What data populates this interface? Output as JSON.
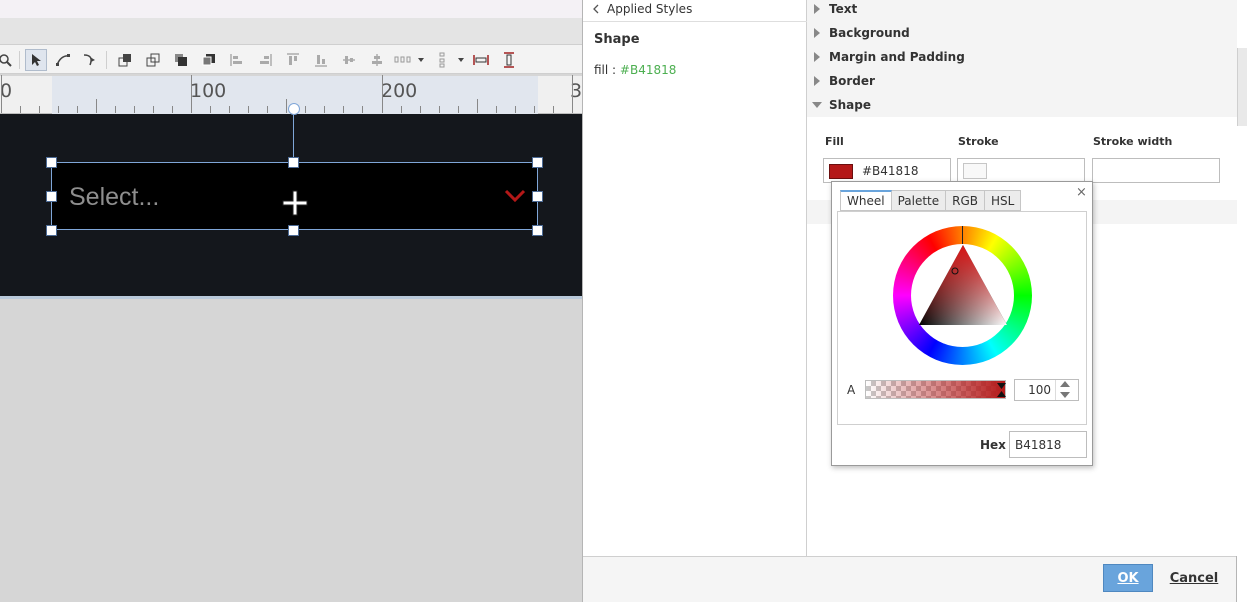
{
  "ruler": {
    "label_0": "0",
    "label_100": "100",
    "label_200": "200",
    "label_300": "3"
  },
  "component": {
    "placeholder": "Select..."
  },
  "styles_panel": {
    "back_label": "Applied Styles",
    "shape_title": "Shape",
    "fill_key": "fill",
    "fill_value": "#B41818"
  },
  "sections": {
    "text": "Text",
    "background": "Background",
    "margin_padding": "Margin and Padding",
    "border": "Border",
    "shape": "Shape"
  },
  "shape_fields": {
    "fill_label": "Fill",
    "stroke_label": "Stroke",
    "stroke_width_label": "Stroke width",
    "fill_value": "#B41818",
    "stroke_width_value": ""
  },
  "picker": {
    "tabs": [
      "Wheel",
      "Palette",
      "RGB",
      "HSL"
    ],
    "active_tab": "Wheel",
    "alpha_label": "A",
    "alpha_value": "100",
    "hex_label": "Hex",
    "hex_value": "B41818",
    "close_glyph": "×"
  },
  "footer": {
    "ok_label": "OK",
    "cancel_label": "Cancel"
  },
  "colors": {
    "fill": "#B41818",
    "accent": "#69A4DC",
    "style_value": "#4CAF50"
  }
}
